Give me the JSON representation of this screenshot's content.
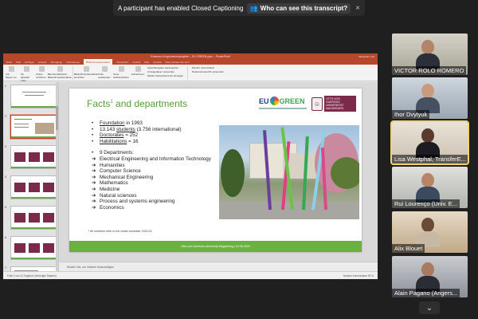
{
  "banner": {
    "message": "A participant has enabled Closed Captioning",
    "who_button": "Who can see this transcript?",
    "close": "×"
  },
  "ppt": {
    "window_title": "Erasmus Kooperationsprojekte – EU GREEN.pptx – PowerPoint",
    "account": "Westphal, Lisa",
    "tabs": [
      "Datei",
      "Start",
      "Einfügen",
      "Entwurf",
      "Übergänge",
      "Animationen",
      "Bildschirmpräsentation",
      "Überprüfen",
      "Ansicht",
      "Hilfe",
      "Acrobat",
      "Was möchten Sie tun?"
    ],
    "active_tab": "Bildschirmpräsentation",
    "ribbon_tools": [
      "Von Beginn an",
      "Ab aktueller Folie",
      "Online vorführen",
      "Benutzerdefinierte Bildschirmpräsentation",
      "Bildschirmpräsentation einrichten",
      "Folie ausblenden",
      "Neue Einblendzeiten",
      "Aufzeichnen"
    ],
    "ribbon_checks": [
      "Sprachausgabe wiedergeben",
      "Anzeigedauer verwenden",
      "Medien-Steuerelemente anzeigen"
    ],
    "monitor_label": "Monitor: Automatisch",
    "presenter_label": "Referentenansicht verwenden",
    "notes_placeholder": "Klicken Sie, um Notizen hinzuzufügen",
    "status_left": "Folie 2 von 11   Englisch (Vereinigte Staaten)",
    "status_right": "Notizen   Kommentare   93 %",
    "thumb_numbers": [
      "1",
      "2",
      "3",
      "4",
      "5",
      "6",
      "7"
    ]
  },
  "slide": {
    "title": "Facts",
    "title_sup": "1",
    "title_rest": " and departments",
    "logo_eu_left": "EU",
    "logo_eu_right": "GREEN",
    "logo_uni_text": "OTTO VON GUERICKE UNIVERSITÄT MAGDEBURG",
    "logo_uni_face": "☺",
    "bullets": [
      {
        "mark": "•",
        "underlined": "Foundation",
        "rest": " in 1993"
      },
      {
        "mark": "•",
        "underlined": "",
        "rest": "13.143 "
      },
      {
        "mark": "•",
        "underlined": "Doctorates",
        "rest": " = 252"
      },
      {
        "mark": "•",
        "underlined": "Habilitations",
        "rest": " = 16"
      }
    ],
    "students_underlined": "students",
    "students_rest": " (3.756 international)",
    "departments_heading": "9 Departments:",
    "departments": [
      "Electrical Engineering and Information Technology",
      "Humanities",
      "Computer Science",
      "Mechanical Engineering",
      "Mathematics",
      "Medicine",
      "Natural sciences",
      "Process and systems engineering",
      "Economics"
    ],
    "arrow": "➔",
    "footnote": "¹ All numbers refer to the winter semester 2021/22",
    "footer": "Otto-von-Guericke-University Magdeburg  |  15.06.2022"
  },
  "participants": [
    {
      "name": "VICTOR ROLO ROMERO",
      "active": false
    },
    {
      "name": "Ihor Dvylyuk",
      "active": false
    },
    {
      "name": "Lisa Westphal, TransferE...",
      "active": true
    },
    {
      "name": "Rui Lourenço (Univ. E...",
      "active": false
    },
    {
      "name": "Alix Blouet",
      "active": false
    },
    {
      "name": "Alain Pagano (Angers...",
      "active": false
    }
  ],
  "more_chevron": "⌄"
}
